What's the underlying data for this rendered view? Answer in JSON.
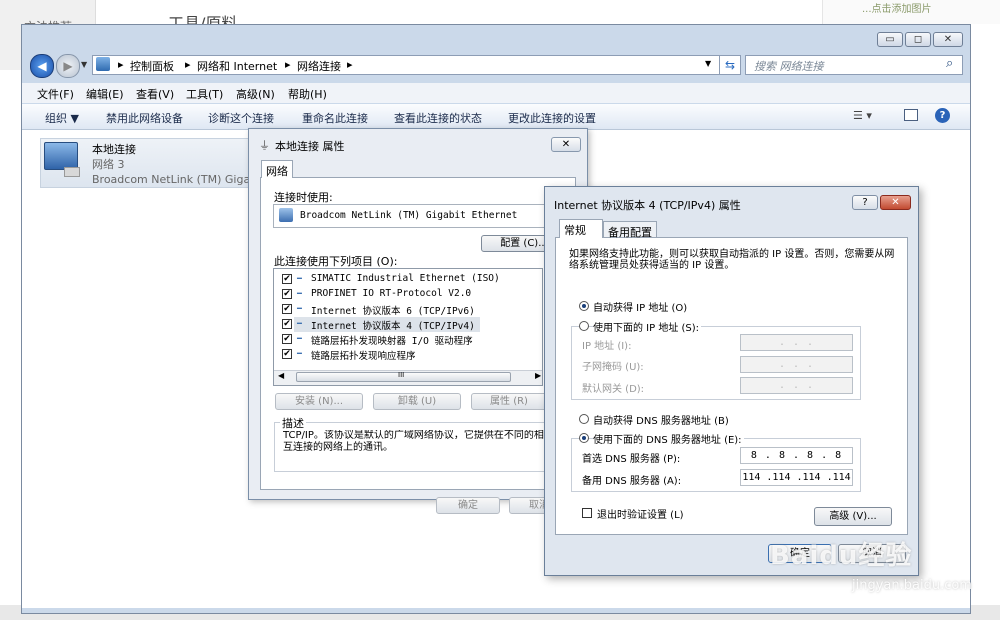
{
  "background": {
    "left_text": "方法推荐",
    "title": "工具/原料",
    "right_text": "...点击添加图片"
  },
  "window": {
    "controls": {
      "minimize": "▭",
      "maximize": "◻",
      "close": "✕"
    },
    "breadcrumb": [
      "控制面板",
      "网络和 Internet",
      "网络连接"
    ],
    "search_placeholder": "搜索 网络连接",
    "menu": [
      "文件(F)",
      "编辑(E)",
      "查看(V)",
      "工具(T)",
      "高级(N)",
      "帮助(H)"
    ],
    "toolbar": [
      "组织 ▼",
      "禁用此网络设备",
      "诊断这个连接",
      "重命名此连接",
      "查看此连接的状态",
      "更改此连接的设置"
    ],
    "connection": {
      "name": "本地连接",
      "network": "网络  3",
      "adapter": "Broadcom NetLink (TM) Giga"
    }
  },
  "dialog1": {
    "title": "本地连接 属性",
    "close": "✕",
    "tab": "网络",
    "connect_using_label": "连接时使用:",
    "adapter": "Broadcom NetLink (TM) Gigabit Ethernet",
    "configure_button": "配置 (C)...",
    "items_label": "此连接使用下列项目 (O):",
    "items": [
      "SIMATIC Industrial Ethernet (ISO)",
      "PROFINET IO RT-Protocol V2.0",
      "Internet 协议版本 6 (TCP/IPv6)",
      "Internet 协议版本 4 (TCP/IPv4)",
      "链路层拓扑发现映射器 I/O 驱动程序",
      "链路层拓扑发现响应程序"
    ],
    "scroll_mid": "III",
    "install_button": "安装 (N)...",
    "uninstall_button": "卸载 (U)",
    "properties_button": "属性 (R)",
    "description_label": "描述",
    "description": "TCP/IP。该协议是默认的广域网络协议，它提供在不同的相互连接的网络上的通讯。",
    "ok_button": "确定",
    "cancel_button": "取消"
  },
  "dialog2": {
    "title": "Internet 协议版本 4 (TCP/IPv4) 属性",
    "help": "?",
    "close": "✕",
    "tabs": [
      "常规",
      "备用配置"
    ],
    "intro": "如果网络支持此功能，则可以获取自动指派的 IP 设置。否则，您需要从网络系统管理员处获得适当的 IP 设置。",
    "auto_ip": "自动获得 IP 地址 (O)",
    "manual_ip": "使用下面的 IP 地址 (S):",
    "ip_label": "IP 地址 (I):",
    "mask_label": "子网掩码 (U):",
    "gateway_label": "默认网关 (D):",
    "empty_ip": ".   .   .",
    "auto_dns": "自动获得 DNS 服务器地址 (B)",
    "manual_dns": "使用下面的 DNS 服务器地址 (E):",
    "preferred_dns_label": "首选 DNS 服务器 (P):",
    "preferred_dns": "8 . 8 . 8 . 8",
    "alternate_dns_label": "备用 DNS 服务器 (A):",
    "alternate_dns": "114 .114 .114 .114",
    "validate": "退出时验证设置 (L)",
    "advanced_button": "高级 (V)...",
    "ok_button": "确定",
    "cancel_button": "取消"
  },
  "watermark": {
    "brand": "Baidu经验",
    "url": "jingyan.baidu.com"
  }
}
